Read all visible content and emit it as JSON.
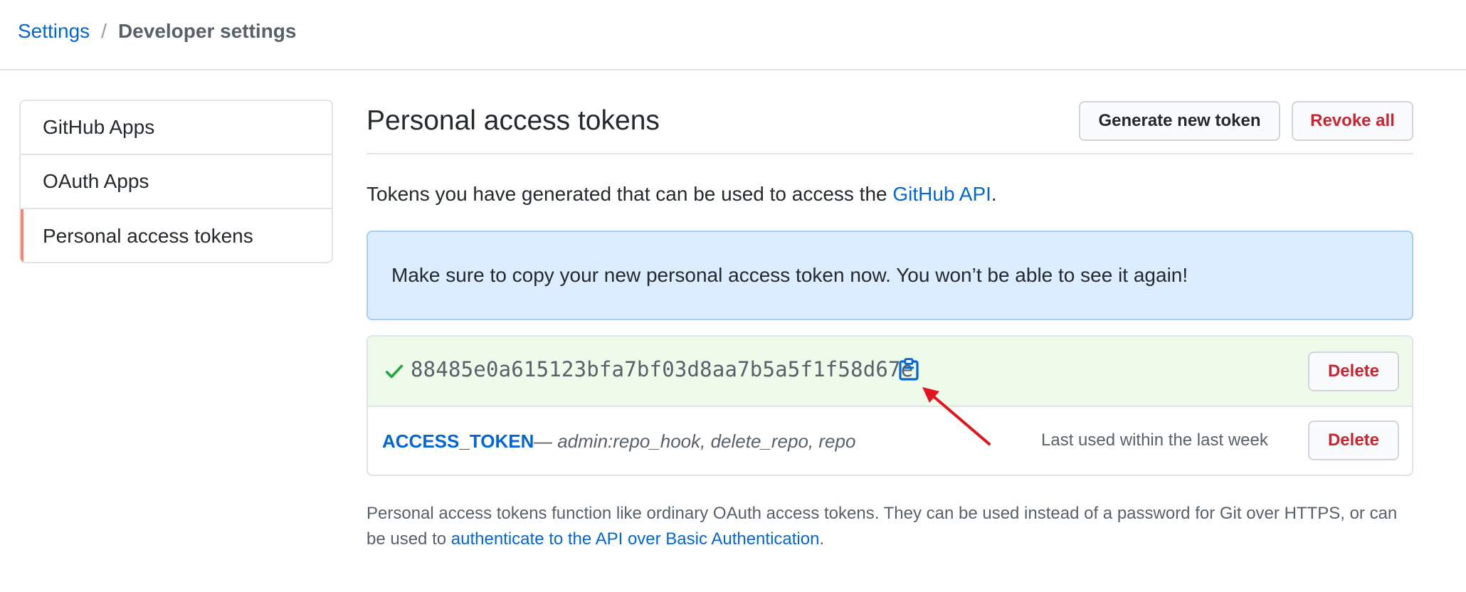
{
  "breadcrumb": {
    "root": "Settings",
    "separator": "/",
    "current": "Developer settings"
  },
  "sidebar": {
    "items": [
      {
        "label": "GitHub Apps",
        "selected": false
      },
      {
        "label": "OAuth Apps",
        "selected": false
      },
      {
        "label": "Personal access tokens",
        "selected": true
      }
    ],
    "selected_accent": "#f9826c"
  },
  "main": {
    "title": "Personal access tokens",
    "buttons": {
      "generate": "Generate new token",
      "revoke_all": "Revoke all"
    },
    "intro": {
      "text": "Tokens you have generated that can be used to access the ",
      "link": "GitHub API",
      "suffix": "."
    },
    "flash": "Make sure to copy your new personal access token now. You won’t be able to see it again!",
    "new_token": {
      "value": "88485e0a615123bfa7bf03d8aa7b5a5f1f58d67e",
      "delete_label": "Delete",
      "icons": [
        "check-icon",
        "clipboard-icon"
      ]
    },
    "token": {
      "name": "ACCESS_TOKEN",
      "scopes": "— admin:repo_hook, delete_repo, repo",
      "last_used": "Last used within the last week",
      "delete_label": "Delete"
    },
    "note": {
      "text": "Personal access tokens function like ordinary OAuth access tokens. They can be used instead of a password for Git over HTTPS, or can be used to ",
      "link": "authenticate to the API over Basic Authentication",
      "suffix": "."
    }
  },
  "colors": {
    "link": "#0366d6",
    "danger": "#cb2431",
    "flash_bg": "#dbedff",
    "new_token_bg": "#eefbeb",
    "success": "#28a745",
    "annotation": "#e3141e"
  }
}
